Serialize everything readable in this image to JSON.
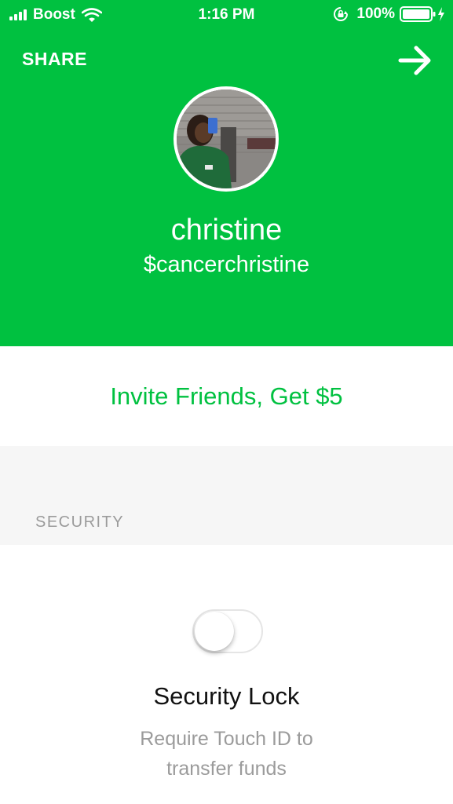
{
  "status_bar": {
    "carrier": "Boost",
    "time": "1:16 PM",
    "battery": "100%"
  },
  "header": {
    "share_label": "SHARE",
    "forward_icon": "arrow-right-icon",
    "background_color": "#00c140"
  },
  "profile": {
    "name": "christine",
    "cashtag": "$cancerchristine"
  },
  "invite": {
    "label": "Invite Friends, Get $5",
    "color": "#00c140"
  },
  "security": {
    "section_label": "SECURITY",
    "toggle_on": false,
    "title": "Security Lock",
    "description": "Require Touch ID to transfer funds"
  }
}
